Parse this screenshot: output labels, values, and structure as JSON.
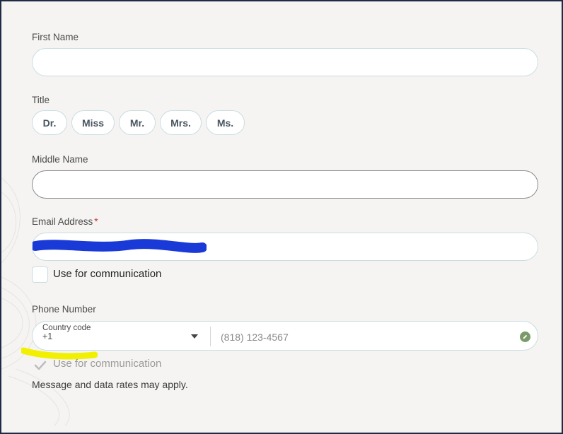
{
  "form": {
    "first_name": {
      "label": "First Name",
      "value": ""
    },
    "title": {
      "label": "Title",
      "options": [
        "Dr.",
        "Miss",
        "Mr.",
        "Mrs.",
        "Ms."
      ]
    },
    "middle_name": {
      "label": "Middle Name",
      "value": ""
    },
    "email": {
      "label": "Email Address",
      "required_mark": "*",
      "use_for_communication": "Use for communication"
    },
    "phone": {
      "label": "Phone Number",
      "country_code_label": "Country code",
      "country_code_value": "+1",
      "placeholder": "(818) 123-4567",
      "use_for_communication": "Use for communication",
      "note": "Message and data rates may apply."
    }
  },
  "colors": {
    "background": "#f5f4f2",
    "input_border": "#c9dde0",
    "required": "#c23934",
    "redaction": "#1a3ad8",
    "highlight": "#f1f000"
  },
  "icons": {
    "edit": "pencil-edit-icon",
    "dropdown": "caret-down-icon",
    "check": "check-icon"
  }
}
